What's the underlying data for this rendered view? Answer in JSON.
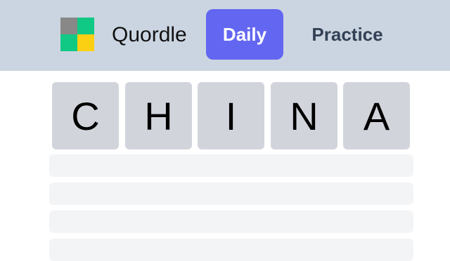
{
  "header": {
    "brand": "Quordle",
    "logo_colors": [
      "#888888",
      "#10c985",
      "#10c985",
      "#fcd012"
    ],
    "nav": {
      "daily_label": "Daily",
      "practice_label": "Practice"
    },
    "accent_color": "#6366f1"
  },
  "board": {
    "guess_row": [
      "C",
      "H",
      "I",
      "N",
      "A"
    ],
    "empty_rows": 4
  }
}
